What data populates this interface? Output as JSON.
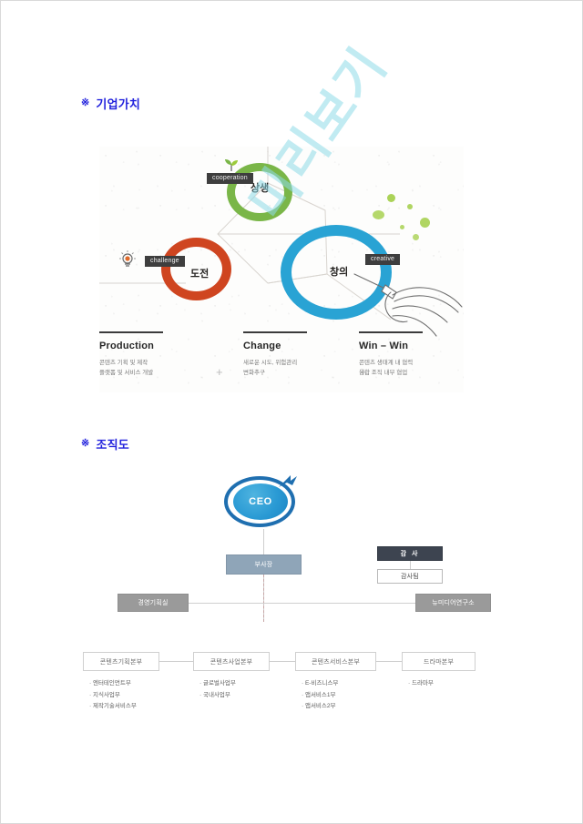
{
  "sections": {
    "value": {
      "mark": "※",
      "title": "기업가치"
    },
    "org": {
      "mark": "※",
      "title": "조직도"
    }
  },
  "watermark": {
    "text": "미리보기",
    "color": "#8fdbe8"
  },
  "value_figure": {
    "nodes": [
      {
        "tag": "cooperation",
        "label": "상생",
        "color": "#7ab648",
        "icon": "sprout-icon"
      },
      {
        "tag": "challenge",
        "label": "도전",
        "color": "#cf4520",
        "icon": "lightbulb-icon"
      },
      {
        "tag": "creative",
        "label": "창의",
        "color": "#29a3d4",
        "icon": "hand-drawing-icon"
      }
    ],
    "columns": [
      {
        "title": "Production",
        "desc": "콘텐츠 기획 및 제작\n플랫폼 및 서비스 개발"
      },
      {
        "title": "Change",
        "desc": "새로운 시도, 위험관리\n변화추구"
      },
      {
        "title": "Win – Win",
        "desc": "콘텐츠 생태계 내 협력\n융합 조직 내부 협업"
      }
    ],
    "separator": "+"
  },
  "org_chart": {
    "ceo": "CEO",
    "vice_president": "부사장",
    "audit_head": "감 사",
    "audit_team": "감사팀",
    "staff_left": "경영기획실",
    "staff_right": "뉴미디어연구소",
    "divisions": [
      {
        "name": "콘텐츠기획본부",
        "teams": "· 엔터테인먼트부\n· 지식사업부\n· 제작기술서비스부"
      },
      {
        "name": "콘텐츠사업본부",
        "teams": "· 글로벌사업부\n· 국내사업부"
      },
      {
        "name": "콘텐츠서비스본부",
        "teams": "· E-비즈니스부\n· 앱서비스1부\n· 앱서비스2부"
      },
      {
        "name": "드라마본부",
        "teams": "· 드라마부"
      }
    ]
  }
}
